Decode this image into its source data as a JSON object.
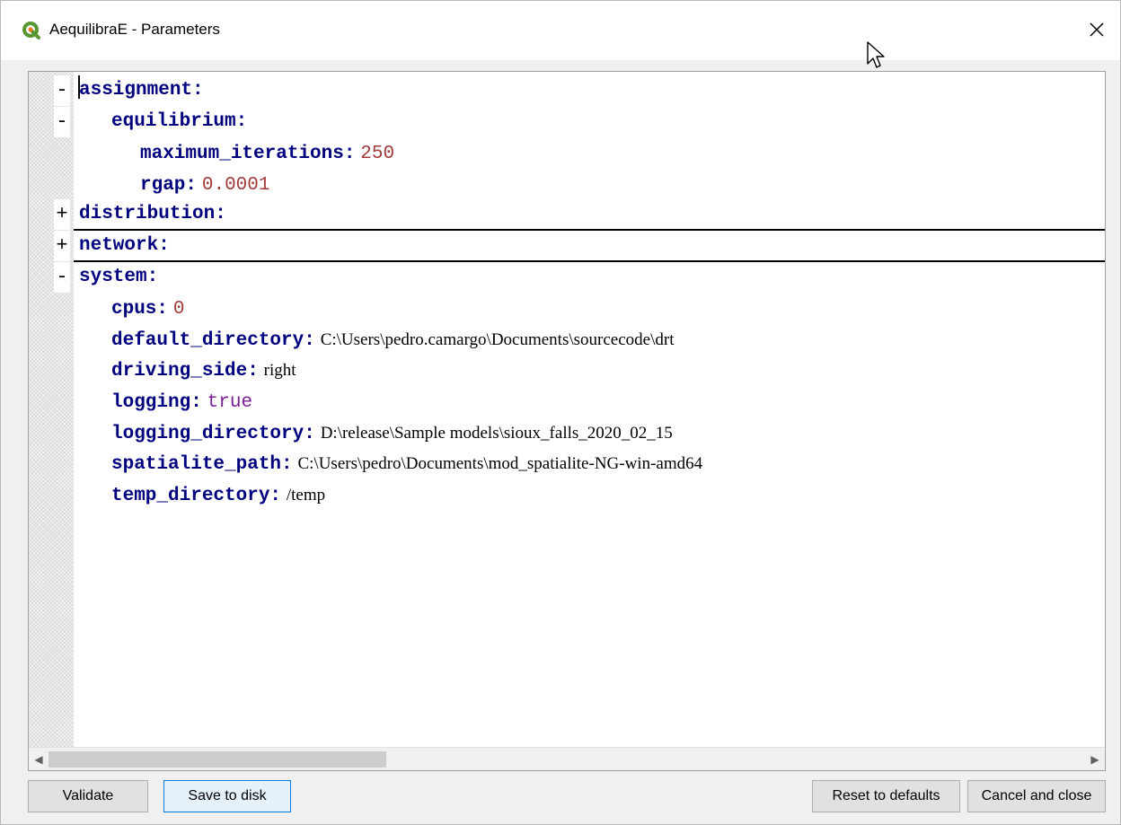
{
  "window": {
    "title": "AequilibraE - Parameters",
    "close_glyph": "✕"
  },
  "editor": {
    "lines": [
      {
        "fold": "-",
        "key": "assignment:",
        "value": "",
        "value_type": "",
        "separator": false
      },
      {
        "fold": "-",
        "key": "equilibrium:",
        "value": "",
        "value_type": "",
        "separator": false
      },
      {
        "fold": "",
        "key": "maximum_iterations:",
        "value": "250",
        "value_type": "number",
        "separator": false
      },
      {
        "fold": "",
        "key": "rgap:",
        "value": "0.0001",
        "value_type": "number",
        "separator": false
      },
      {
        "fold": "+",
        "key": "distribution:",
        "value": "",
        "value_type": "",
        "separator": true
      },
      {
        "fold": "+",
        "key": "network:",
        "value": "",
        "value_type": "",
        "separator": true
      },
      {
        "fold": "-",
        "key": "system:",
        "value": "",
        "value_type": "",
        "separator": false
      },
      {
        "fold": "",
        "key": "cpus:",
        "value": "0",
        "value_type": "number",
        "separator": false
      },
      {
        "fold": "",
        "key": "default_directory:",
        "value": "C:\\Users\\pedro.camargo\\Documents\\sourcecode\\drt",
        "value_type": "plain",
        "separator": false
      },
      {
        "fold": "",
        "key": "driving_side:",
        "value": "right",
        "value_type": "plain",
        "separator": false
      },
      {
        "fold": "",
        "key": "logging:",
        "value": "true",
        "value_type": "keyword",
        "separator": false
      },
      {
        "fold": "",
        "key": "logging_directory:",
        "value": "D:\\release\\Sample models\\sioux_falls_2020_02_15",
        "value_type": "plain",
        "separator": false
      },
      {
        "fold": "",
        "key": "spatialite_path:",
        "value": "C:\\Users\\pedro\\Documents\\mod_spatialite-NG-win-amd64",
        "value_type": "plain",
        "separator": false
      },
      {
        "fold": "",
        "key": "temp_directory:",
        "value": "/temp",
        "value_type": "plain",
        "separator": false
      }
    ]
  },
  "buttons": {
    "validate": "Validate",
    "save": "Save to disk",
    "reset": "Reset to defaults",
    "cancel": "Cancel and close"
  },
  "colors": {
    "key": "#00007f",
    "number": "#a33a3a",
    "keyword": "#7a1f95",
    "focus_border": "#0078d7"
  }
}
